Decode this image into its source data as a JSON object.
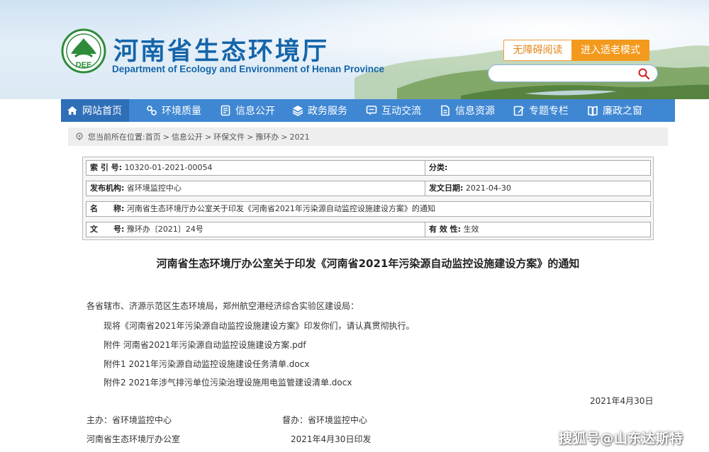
{
  "header": {
    "title": "河南省生态环境厅",
    "subtitle": "Department of Ecology and Environment of Henan Province",
    "logo_text": "DEE",
    "barrier_free_label": "无障碍阅读",
    "elder_mode_label": "进入适老模式",
    "search_placeholder": ""
  },
  "nav": {
    "items": [
      {
        "label": "网站首页",
        "icon": "home-icon"
      },
      {
        "label": "环境质量",
        "icon": "environment-icon"
      },
      {
        "label": "信息公开",
        "icon": "document-icon"
      },
      {
        "label": "政务服务",
        "icon": "layers-icon"
      },
      {
        "label": "互动交流",
        "icon": "chat-icon"
      },
      {
        "label": "信息资源",
        "icon": "file-icon"
      },
      {
        "label": "专题专栏",
        "icon": "edit-icon"
      },
      {
        "label": "廉政之窗",
        "icon": "book-icon"
      }
    ]
  },
  "breadcrumb": {
    "prefix": "您当前所在位置:",
    "items": [
      "首页",
      "信息公开",
      "环保文件",
      "豫环办",
      "2021"
    ],
    "separator": ">"
  },
  "meta": {
    "index_label": "索 引 号:",
    "index_value": "10320-01-2021-00054",
    "category_label": "分类:",
    "category_value": "",
    "publisher_label": "发布机构:",
    "publisher_value": "省环境监控中心",
    "date_label": "发文日期:",
    "date_value": "2021-04-30",
    "name_label": "名　　称:",
    "name_value": "河南省生态环境厅办公室关于印发《河南省2021年污染源自动监控设施建设方案》的通知",
    "docno_label": "文　　号:",
    "docno_value": "豫环办〔2021〕24号",
    "validity_label": "有 效 性:",
    "validity_value": "生效"
  },
  "article": {
    "title": "河南省生态环境厅办公室关于印发《河南省2021年污染源自动监控设施建设方案》的通知",
    "salutation": "各省辖市、济源示范区生态环境局，郑州航空港经济综合实验区建设局：",
    "body": "现将《河南省2021年污染源自动监控设施建设方案》印发你们，请认真贯彻执行。",
    "attachments": [
      "附件 河南省2021年污染源自动监控设施建设方案.pdf",
      "附件1 2021年污染源自动监控设施建设任务清单.docx",
      "附件2 2021年涉气排污单位污染治理设施用电监管建设清单.docx"
    ],
    "sign_date": "2021年4月30日",
    "host_label": "主办：省环境监控中心",
    "supervisor_label": "督办：省环境监控中心",
    "office": "河南省生态环境厅办公室",
    "print_date": "2021年4月30日印发"
  },
  "watermark": "搜狐号@山东达斯特",
  "colors": {
    "brand_blue": "#1565a9",
    "nav_blue": "#3f87d3",
    "accent_orange": "#f39a1e"
  }
}
